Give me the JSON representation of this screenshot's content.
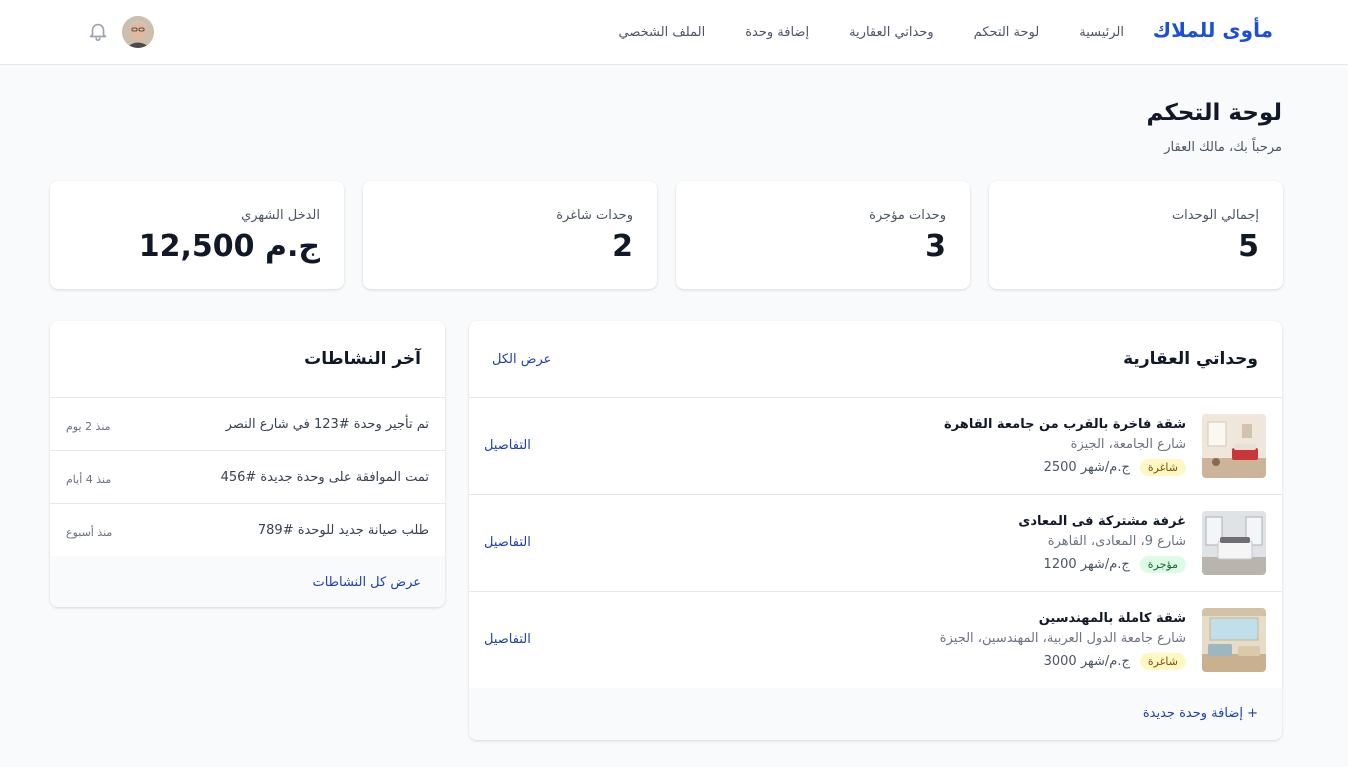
{
  "nav": {
    "brand": "مأوى للملاك",
    "links": [
      "الرئيسية",
      "لوحة التحكم",
      "وحداتي العقارية",
      "إضافة وحدة",
      "الملف الشخصي"
    ],
    "icons": {
      "notifications": "bell-icon",
      "profile": "avatar"
    }
  },
  "header": {
    "title": "لوحة التحكم",
    "subtitle": "مرحباً بك، مالك العقار"
  },
  "stats": [
    {
      "label": "إجمالي الوحدات",
      "value": "5"
    },
    {
      "label": "وحدات مؤجرة",
      "value": "3"
    },
    {
      "label": "وحدات شاغرة",
      "value": "2"
    },
    {
      "label": "الدخل الشهري",
      "value": "12,500 ج.م"
    }
  ],
  "units_panel": {
    "title": "وحداتي العقارية",
    "view_all": "عرض الكل",
    "details_label": "التفاصيل",
    "add_unit": "إضافة وحدة جديدة +",
    "units": [
      {
        "title": "شقة فاخرة بالقرب من جامعة القاهرة",
        "address": "شارع الجامعة، الجيزة",
        "price": "2500 ج.م/شهر",
        "status": "شاغرة"
      },
      {
        "title": "غرفة مشتركة فى المعادى",
        "address": "شارع 9، المعادى، القاهرة",
        "price": "1200 ج.م/شهر",
        "status": "مؤجرة"
      },
      {
        "title": "شقة كاملة بالمهندسين",
        "address": "شارع جامعة الدول العربية، المهندسين، الجيزة",
        "price": "3000 ج.م/شهر",
        "status": "شاغرة"
      }
    ]
  },
  "activity_panel": {
    "title": "آخر النشاطات",
    "footer_link": "عرض كل النشاطات",
    "items": [
      {
        "text": "تم تأجير وحدة #123 في شارع النصر",
        "time": "منذ 2 يوم"
      },
      {
        "text": "تمت الموافقة على وحدة جديدة #456",
        "time": "منذ 4 أيام"
      },
      {
        "text": "طلب صيانة جديد للوحدة #789",
        "time": "منذ أسبوع"
      }
    ]
  },
  "colors": {
    "brand": "#1d4ed8",
    "link": "#1e40af",
    "vacant_badge_bg": "#fef9c3",
    "vacant_badge_text": "#854d0e",
    "rented_badge_bg": "#dcfce7",
    "rented_badge_text": "#166534"
  }
}
